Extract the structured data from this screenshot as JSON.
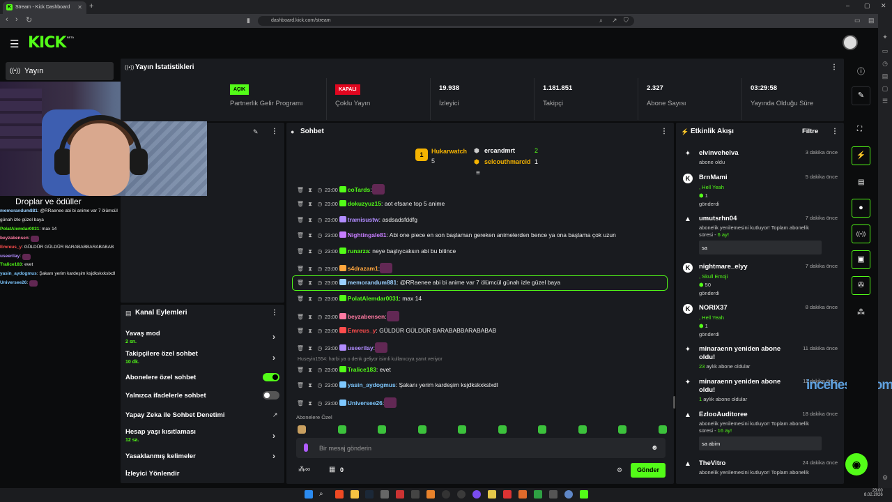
{
  "browser": {
    "tab_title": "Stream - Kick Dashboard",
    "url": "dashboard.kick.com/stream"
  },
  "header": {
    "logo": "KICK",
    "beta": "BETA"
  },
  "nav": {
    "active": "Yayın",
    "drops": "Droplar ve ödüller"
  },
  "left_chat": [
    {
      "user": "memorandum881",
      "text": ": @RRaenee abi bi anime var 7 ölümcül günah izle güzel baya",
      "color": "#9ad0ff"
    },
    {
      "user": "PolatAlemdar0031",
      "text": ": max 14",
      "color": "#53fc18"
    },
    {
      "user": "beyzabensen",
      "text": ": ",
      "color": "#ff7aa2"
    },
    {
      "user": "Emreus_y",
      "text": ": GÜLDÜR GÜLDÜR BARABABBARABABAB",
      "color": "#ff4d4d"
    },
    {
      "user": "useerilay",
      "text": ": ",
      "color": "#b18cff"
    },
    {
      "user": "Tralice183",
      "text": ": evet",
      "color": "#53fc18"
    },
    {
      "user": "yasin_aydogmus",
      "text": ": Şakanı yerim kardeşim ksjdkskxkslxdl",
      "color": "#7ec8ff"
    },
    {
      "user": "Universee26",
      "text": ": ",
      "color": "#7ec8ff"
    }
  ],
  "stats": {
    "title": "Yayın İstatistikleri",
    "partner": {
      "badge": "AÇIK",
      "label": "Partnerlik Gelir Programı"
    },
    "multi": {
      "badge": "KAPALI",
      "label": "Çoklu Yayın"
    },
    "viewers": {
      "value": "19.938",
      "label": "İzleyici"
    },
    "followers": {
      "value": "1.181.851",
      "label": "Takipçi"
    },
    "subs": {
      "value": "2.327",
      "label": "Abone Sayısı"
    },
    "uptime": {
      "value": "03:29:58",
      "label": "Yayında Olduğu Süre"
    }
  },
  "actions": {
    "title": "Kanal Eylemleri",
    "slow": {
      "label": "Yavaş mod",
      "sub": "2 sn."
    },
    "followers": {
      "label": "Takipçilere özel sohbet",
      "sub": "10 dk."
    },
    "subs": {
      "label": "Abonelere özel sohbet"
    },
    "emotes": {
      "label": "Yalnızca ifadelerle sohbet"
    },
    "ai": {
      "label": "Yapay Zeka ile Sohbet Denetimi"
    },
    "age": {
      "label": "Hesap yaşı kısıtlaması",
      "sub": "12 sa."
    },
    "banned": {
      "label": "Yasaklanmış kelimeler"
    },
    "redirect": {
      "label": "İzleyici Yönlendir"
    }
  },
  "chat": {
    "title": "Sohbet",
    "top": [
      {
        "name": "Hukarwatch",
        "count": "5",
        "rank": "1"
      },
      {
        "name": "ercandmrt",
        "count": "2"
      },
      {
        "name": "selcouthmarcid",
        "count": "1"
      }
    ],
    "messages": [
      {
        "time": "23:00",
        "user": "coTards",
        "text": ":",
        "color": "#53fc18",
        "emote": true
      },
      {
        "time": "23:00",
        "user": "dokuzyuz15",
        "text": ": aot efsane top 5 anime",
        "color": "#53fc18"
      },
      {
        "time": "23:00",
        "user": "tramisustw",
        "text": ": asdsadsfddfg",
        "color": "#b18cff"
      },
      {
        "time": "23:00",
        "user": "Nightingale81",
        "text": ": Abi one piece en son başlaman gereken animelerden bence ya ona başlama çok uzun",
        "color": "#c77dff"
      },
      {
        "time": "23:00",
        "user": "runarza",
        "text": ": neye başlıycaksın abi bu bitince",
        "color": "#53fc18"
      },
      {
        "time": "23:00",
        "user": "s4drazam1",
        "text": ":",
        "color": "#ffa63d",
        "emote": true
      },
      {
        "time": "23:00",
        "user": "memorandum881",
        "text": ": @RRaenee abi bi anime var 7 ölümcül günah izle güzel baya",
        "color": "#9ad0ff"
      },
      {
        "time": "23:00",
        "user": "PolatAlemdar0031",
        "text": ": max 14",
        "color": "#53fc18"
      },
      {
        "time": "23:00",
        "user": "beyzabensen",
        "text": ":",
        "color": "#ff7aa2",
        "emote": true
      },
      {
        "time": "23:00",
        "user": "Emreus_y",
        "text": ": GÜLDÜR GÜLDÜR BARABABBARABABAB",
        "color": "#ff4d4d"
      },
      {
        "time": "23:00",
        "user": "useerilay",
        "text": ":",
        "color": "#b18cff",
        "emote": true
      },
      {
        "time": "23:00",
        "user": "Tralice183",
        "text": ": evet",
        "color": "#53fc18"
      },
      {
        "time": "23:00",
        "user": "yasin_aydogmus",
        "text": ": Şakanı yerim kardeşim ksjdkskxkslxdl",
        "color": "#7ec8ff"
      },
      {
        "time": "23:00",
        "user": "Universee26",
        "text": ":",
        "color": "#7ec8ff",
        "emote": true
      }
    ],
    "reply_note": "Huseyin1554: harbi ya o denk geliyor isimli kullanıcıya yanıt veriyor",
    "sub_emotes": "Abonelere Özel",
    "placeholder": "Bir mesaj gönderin",
    "points": "0",
    "send": "Gönder"
  },
  "feed": {
    "title": "Etkinlik Akışı",
    "filter": "Filtre",
    "items": [
      {
        "name": "elvinvehelva",
        "time": "3 dakika önce",
        "desc": "abone oldu"
      },
      {
        "name": "BrnMami",
        "time": "5 dakika önce",
        "gift": ", Hell Yeah",
        "amount": "1",
        "desc": "gönderdi"
      },
      {
        "name": "umutsrhn04",
        "time": "7 dakika önce",
        "desc": "abonelik yenilemesini kutluyor! Toplam abonelik süresi - ",
        "months": "6",
        "suffix": " ay!",
        "msg": "sa"
      },
      {
        "name": "nightmare_elyy",
        "time": "7 dakika önce",
        "gift": ", Skull Emoji",
        "amount": "50",
        "desc": "gönderdi"
      },
      {
        "name": "NORIX37",
        "time": "8 dakika önce",
        "gift": ", Hell Yeah",
        "amount": "1",
        "desc": "gönderdi"
      },
      {
        "name": "minaraenn yeniden abone oldu!",
        "time": "11 dakika önce",
        "count": "23",
        "desc": " aylık abone oldular"
      },
      {
        "name": "minaraenn yeniden abone oldu!",
        "time": "11 dakika önce",
        "count": "1",
        "desc": " aylık abone oldular"
      },
      {
        "name": "EzlooAuditoree",
        "time": "18 dakika önce",
        "desc": "abonelik yenilemesini kutluyor! Toplam abonelik süresi - ",
        "months": "16",
        "suffix": " ay!",
        "msg": "sa abim"
      },
      {
        "name": "TheVitro",
        "time": "24 dakika önce",
        "desc": "abonelik yenilemesini kutluyor! Toplam abonelik"
      }
    ]
  },
  "watermark": "incehesap.com",
  "clock": {
    "time": "23:00",
    "date": "8.02.2026"
  }
}
